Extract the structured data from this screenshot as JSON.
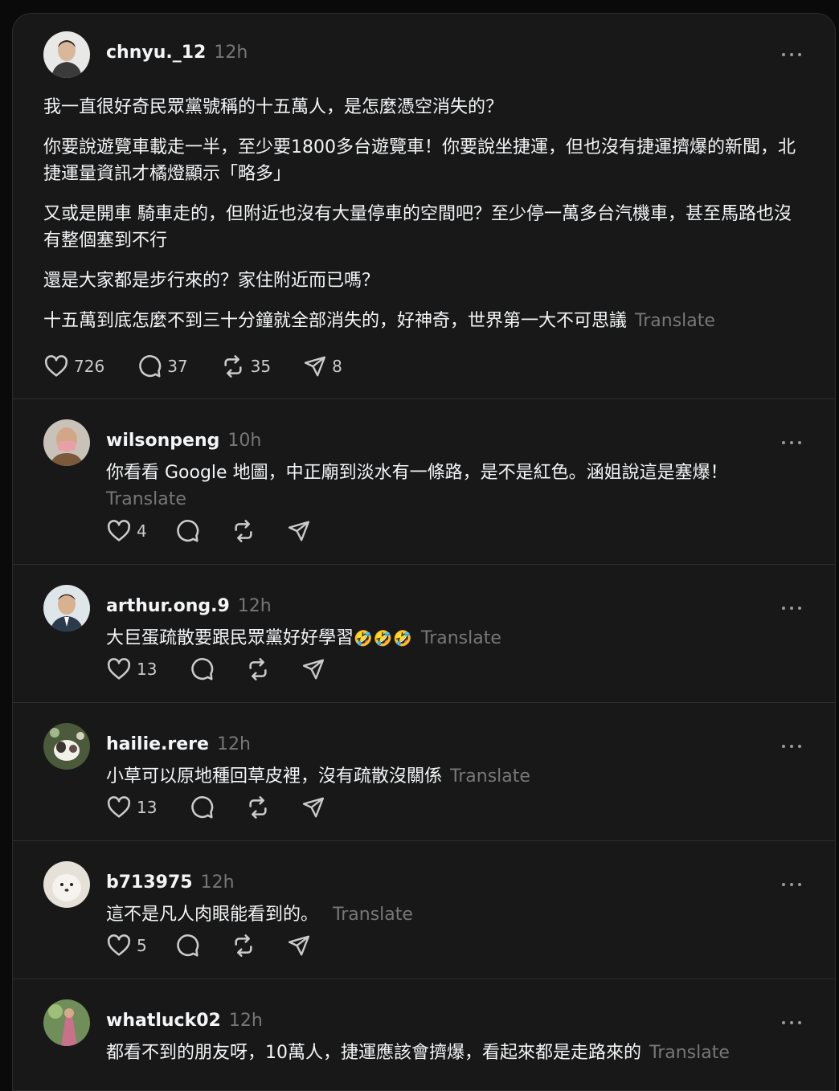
{
  "main_post": {
    "username": "chnyu._12",
    "time": "12h",
    "paragraphs": [
      "我一直很好奇民眾黨號稱的十五萬人，是怎麼憑空消失的？",
      "你要說遊覽車載走一半，至少要1800多台遊覽車！你要說坐捷運，但也沒有捷運擠爆的新聞，北捷運量資訊才橘燈顯示「略多」",
      "又或是開車 騎車走的，但附近也沒有大量停車的空間吧？至少停一萬多台汽機車，甚至馬路也沒有整個塞到不行",
      "還是大家都是步行來的？家住附近而已嗎？",
      "十五萬到底怎麼不到三十分鐘就全部消失的，好神奇，世界第一大不可思議"
    ],
    "translate": "Translate",
    "likes": "726",
    "replies": "37",
    "reposts": "35",
    "shares": "8"
  },
  "replies": [
    {
      "username": "wilsonpeng",
      "time": "10h",
      "text": "你看看 Google 地圖，中正廟到淡水有一條路，是不是紅色。涵姐說這是塞爆！",
      "translate": "Translate",
      "likes": "4"
    },
    {
      "username": "arthur.ong.9",
      "time": "12h",
      "text": "大巨蛋疏散要跟民眾黨好好學習",
      "emoji": "🤣🤣🤣",
      "translate": "Translate",
      "likes": "13"
    },
    {
      "username": "hailie.rere",
      "time": "12h",
      "text": "小草可以原地種回草皮裡，沒有疏散沒關係",
      "translate": "Translate",
      "likes": "13"
    },
    {
      "username": "b713975",
      "time": "12h",
      "text": "這不是凡人肉眼能看到的。",
      "translate": "Translate",
      "likes": "5"
    },
    {
      "username": "whatluck02",
      "time": "12h",
      "text": "都看不到的朋友呀，10萬人，捷運應該會擠爆，看起來都是走路來的",
      "translate": "Translate"
    }
  ],
  "colors": {
    "background": "#181818",
    "text": "#f3f5f7",
    "muted": "#777777"
  },
  "icons": [
    "heart-icon",
    "reply-icon",
    "repost-icon",
    "share-icon",
    "more-icon"
  ]
}
